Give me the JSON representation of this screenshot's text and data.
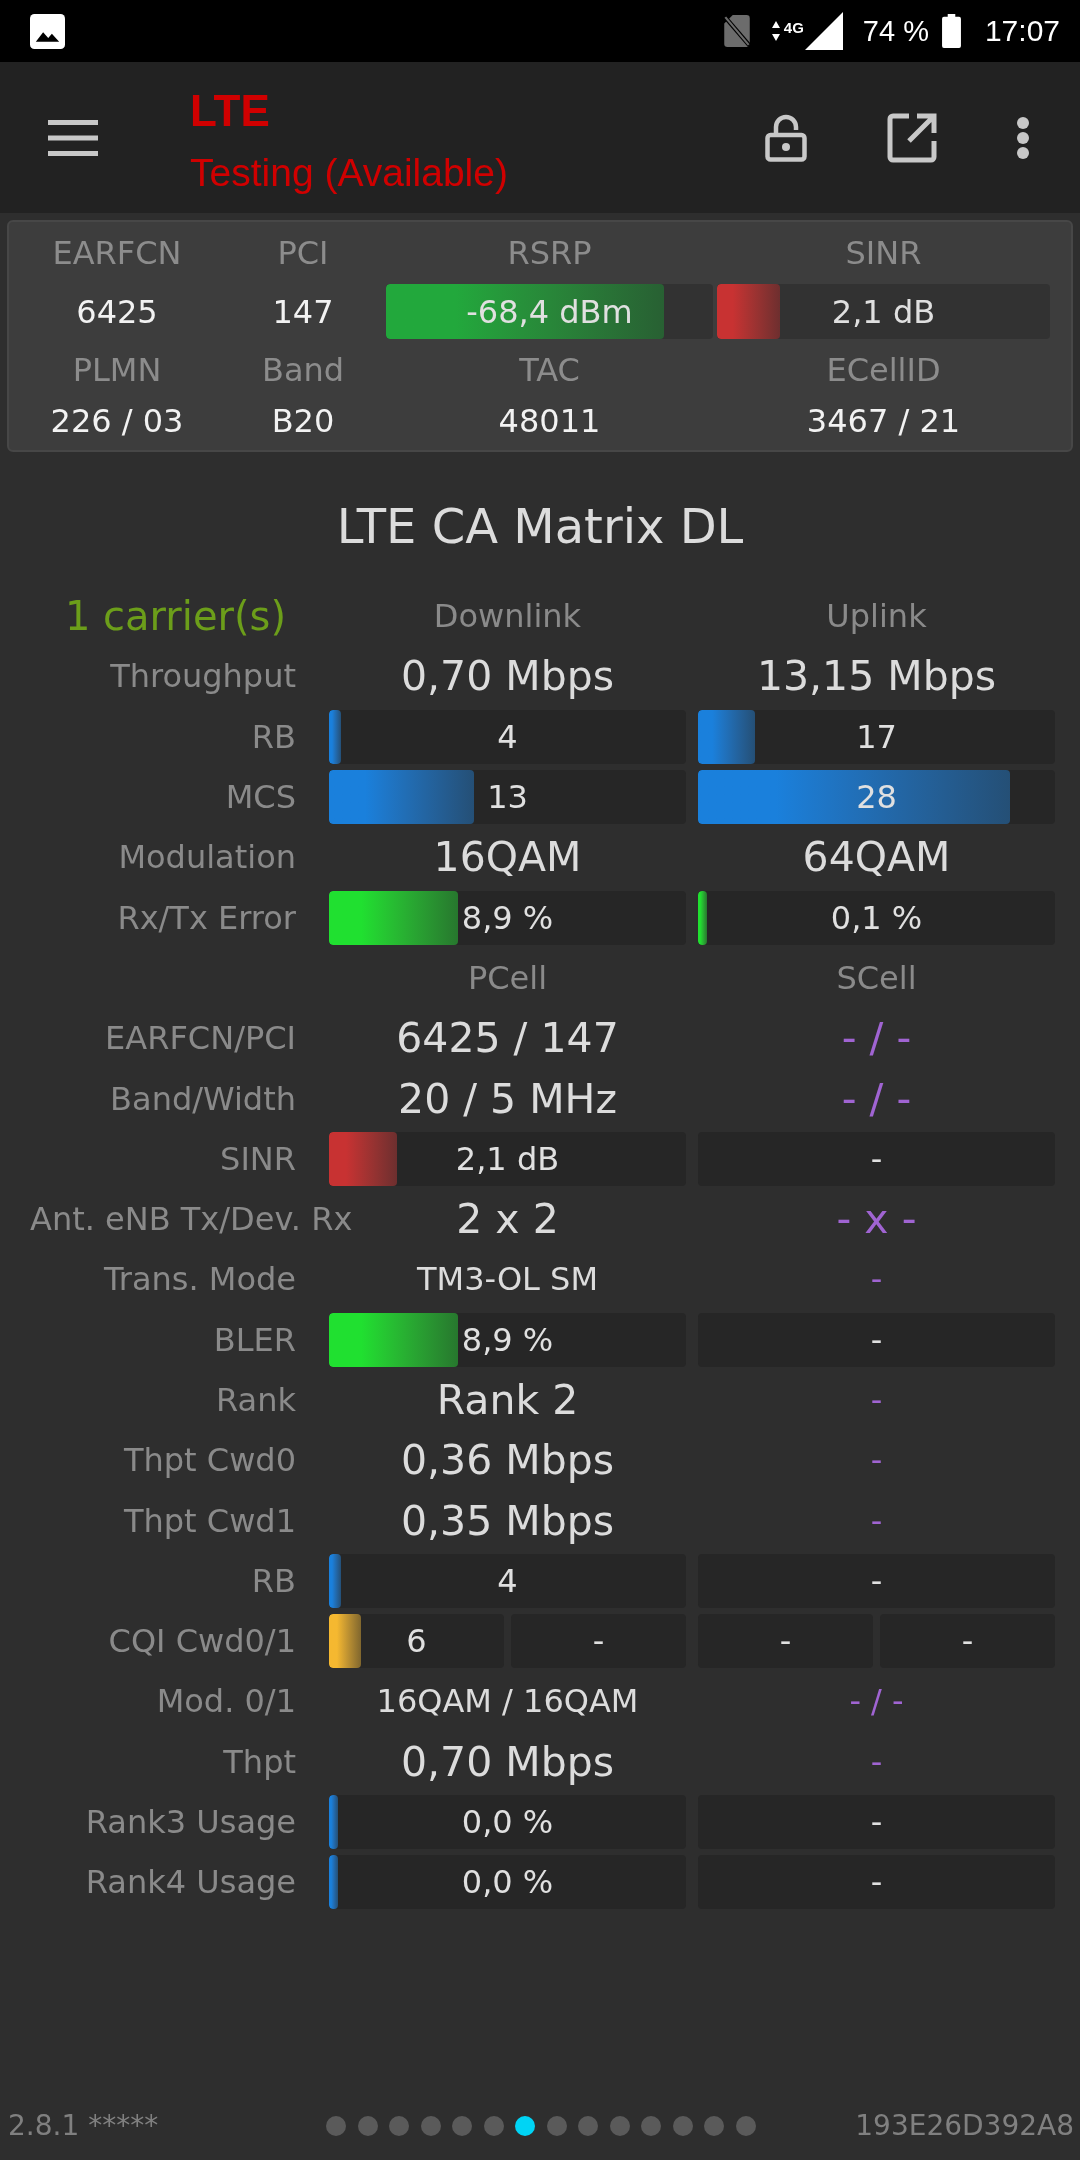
{
  "status_bar": {
    "network_type": "4G",
    "battery_percent": "74 %",
    "time": "17:07"
  },
  "app_bar": {
    "title": "LTE",
    "subtitle": "Testing (Available)"
  },
  "info_panel": {
    "rows": [
      [
        {
          "kind": "text",
          "label": "EARFCN",
          "value": "6425"
        },
        {
          "kind": "text",
          "label": "PCI",
          "value": "147"
        },
        {
          "kind": "bar",
          "label": "RSRP",
          "value": "-68,4 dBm",
          "level": 0.85,
          "color": "#22a83c"
        },
        {
          "kind": "bar",
          "label": "SINR",
          "value": "2,1 dB",
          "level": 0.19,
          "color": "#c83232"
        }
      ],
      [
        {
          "kind": "text",
          "label": "PLMN",
          "value": "226 / 03"
        },
        {
          "kind": "text",
          "label": "Band",
          "value": "B20"
        },
        {
          "kind": "text",
          "label": "TAC",
          "value": "48011"
        },
        {
          "kind": "text",
          "label": "ECellID",
          "value": "3467 / 21"
        }
      ]
    ]
  },
  "matrix": {
    "title": "LTE CA Matrix DL",
    "rows": [
      {
        "kind": "header",
        "label": "1 carrier(s)",
        "cells": [
          {
            "kind": "heading",
            "text": "Downlink"
          },
          {
            "kind": "heading",
            "text": "Uplink"
          }
        ]
      },
      {
        "kind": "data",
        "label": "Throughput",
        "cells": [
          {
            "kind": "large",
            "text": "0,70 Mbps"
          },
          {
            "kind": "large",
            "text": "13,15 Mbps"
          }
        ]
      },
      {
        "kind": "data",
        "label": "RB",
        "cells": [
          {
            "kind": "bar",
            "text": "4",
            "level": 0.035,
            "color": "#1a80dc"
          },
          {
            "kind": "bar",
            "text": "17",
            "level": 0.16,
            "color": "#1a80dc"
          }
        ]
      },
      {
        "kind": "data",
        "label": "MCS",
        "cells": [
          {
            "kind": "bar",
            "text": "13",
            "level": 0.405,
            "color": "#1a80dc"
          },
          {
            "kind": "bar",
            "text": "28",
            "level": 0.873,
            "color": "#1a80dc"
          }
        ]
      },
      {
        "kind": "data",
        "label": "Modulation",
        "cells": [
          {
            "kind": "large",
            "text": "16QAM"
          },
          {
            "kind": "large",
            "text": "64QAM"
          }
        ]
      },
      {
        "kind": "data",
        "label": "Rx/Tx Error",
        "cells": [
          {
            "kind": "bar",
            "text": "8,9 %",
            "level": 0.36,
            "color": "#20e030"
          },
          {
            "kind": "bar",
            "text": "0,1 %",
            "level": 0.025,
            "color": "#20e030"
          }
        ]
      },
      {
        "kind": "header",
        "cells": [
          {
            "kind": "heading",
            "text": "PCell"
          },
          {
            "kind": "heading",
            "text": "SCell"
          }
        ]
      },
      {
        "kind": "data",
        "label": "EARFCN/PCI",
        "cells": [
          {
            "kind": "large",
            "text": "6425 / 147"
          },
          {
            "kind": "large",
            "text": "- / -",
            "color": "#a064d2"
          }
        ]
      },
      {
        "kind": "data",
        "label": "Band/Width",
        "cells": [
          {
            "kind": "large",
            "text": "20 / 5 MHz"
          },
          {
            "kind": "large",
            "text": "- / -",
            "color": "#a064d2"
          }
        ]
      },
      {
        "kind": "data",
        "label": "SINR",
        "cells": [
          {
            "kind": "bar",
            "text": "2,1 dB",
            "level": 0.19,
            "color": "#c83232"
          },
          {
            "kind": "bar",
            "text": "-"
          }
        ]
      },
      {
        "kind": "data",
        "label": "Ant. eNB Tx/Dev. Rx",
        "cells": [
          {
            "kind": "large",
            "text": "2 x 2"
          },
          {
            "kind": "large",
            "text": "- x -",
            "color": "#a064d2"
          }
        ]
      },
      {
        "kind": "data",
        "label": "Trans. Mode",
        "cells": [
          {
            "kind": "text",
            "text": "TM3-OL SM"
          },
          {
            "kind": "text",
            "text": "-",
            "color": "#a064d2"
          }
        ]
      },
      {
        "kind": "data",
        "label": "BLER",
        "cells": [
          {
            "kind": "bar",
            "text": "8,9 %",
            "level": 0.36,
            "color": "#20e030"
          },
          {
            "kind": "bar",
            "text": "-"
          }
        ]
      },
      {
        "kind": "data",
        "label": "Rank",
        "cells": [
          {
            "kind": "large",
            "text": "Rank 2"
          },
          {
            "kind": "text",
            "text": "-",
            "color": "#a064d2"
          }
        ]
      },
      {
        "kind": "data",
        "label": "Thpt Cwd0",
        "cells": [
          {
            "kind": "large",
            "text": "0,36 Mbps"
          },
          {
            "kind": "text",
            "text": "-",
            "color": "#a064d2"
          }
        ]
      },
      {
        "kind": "data",
        "label": "Thpt Cwd1",
        "cells": [
          {
            "kind": "large",
            "text": "0,35 Mbps"
          },
          {
            "kind": "text",
            "text": "-",
            "color": "#a064d2"
          }
        ]
      },
      {
        "kind": "data",
        "label": "RB",
        "cells": [
          {
            "kind": "bar",
            "text": "4",
            "level": 0.035,
            "color": "#1a80dc"
          },
          {
            "kind": "bar",
            "text": "-"
          }
        ]
      },
      {
        "kind": "data",
        "label": "CQI Cwd0/1",
        "cells": [
          {
            "kind": "pair",
            "parts": [
              {
                "kind": "bar",
                "text": "6",
                "level": 0.18,
                "color": "#f5b830"
              },
              {
                "kind": "bar",
                "text": "-"
              }
            ]
          },
          {
            "kind": "pair",
            "parts": [
              {
                "kind": "bar",
                "text": "-"
              },
              {
                "kind": "bar",
                "text": "-"
              }
            ]
          }
        ]
      },
      {
        "kind": "data",
        "label": "Mod. 0/1",
        "cells": [
          {
            "kind": "text",
            "text": "16QAM / 16QAM"
          },
          {
            "kind": "text",
            "text": "- / -",
            "color": "#a064d2"
          }
        ]
      },
      {
        "kind": "data",
        "label": "Thpt",
        "cells": [
          {
            "kind": "large",
            "text": "0,70 Mbps"
          },
          {
            "kind": "text",
            "text": "-",
            "color": "#a064d2"
          }
        ]
      },
      {
        "kind": "data",
        "label": "Rank3 Usage",
        "cells": [
          {
            "kind": "bar",
            "text": "0,0 %",
            "level": 0.025,
            "color": "#1a80dc"
          },
          {
            "kind": "bar",
            "text": "-"
          }
        ]
      },
      {
        "kind": "data",
        "label": "Rank4 Usage",
        "cells": [
          {
            "kind": "bar",
            "text": "0,0 %",
            "level": 0.025,
            "color": "#1a80dc"
          },
          {
            "kind": "bar",
            "text": "-"
          }
        ]
      }
    ]
  },
  "footer": {
    "version": "2.8.1 *****",
    "pager": [
      {
        "selected": false
      },
      {
        "selected": false
      },
      {
        "selected": false
      },
      {
        "selected": false
      },
      {
        "selected": false
      },
      {
        "selected": false
      },
      {
        "selected": true
      },
      {
        "selected": false
      },
      {
        "selected": false
      },
      {
        "selected": false
      },
      {
        "selected": false
      },
      {
        "selected": false
      },
      {
        "selected": false
      },
      {
        "selected": false
      }
    ],
    "device_id": "193E26D392A8"
  }
}
